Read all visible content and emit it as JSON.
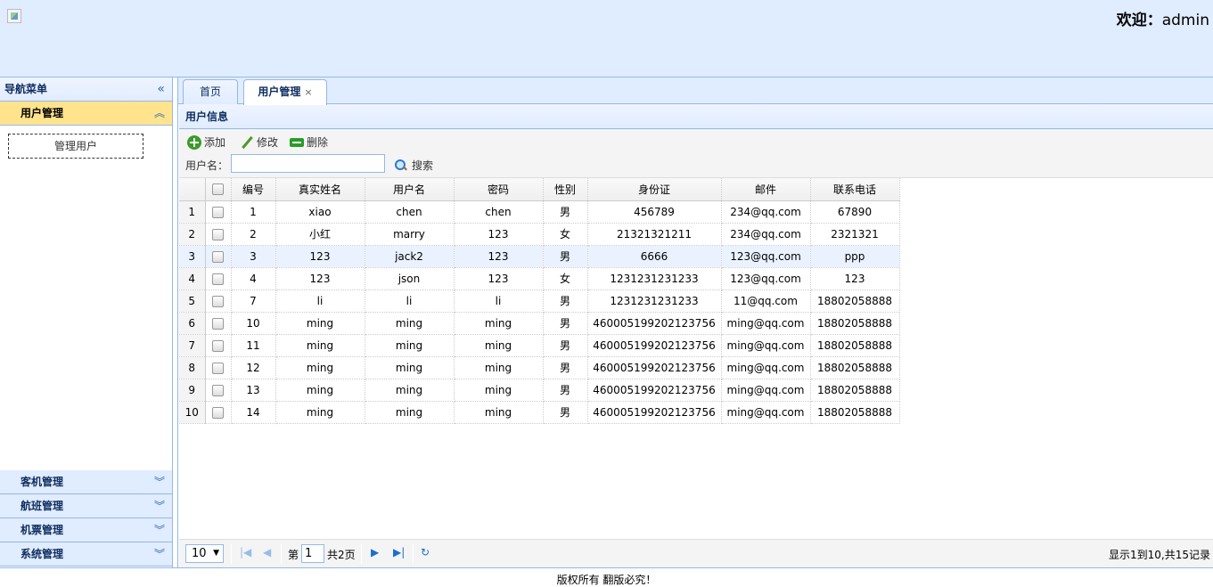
{
  "header": {
    "welcome_label": "欢迎：",
    "username": "admin"
  },
  "west": {
    "title": "导航菜单",
    "accordion": [
      {
        "label": "用户管理"
      },
      {
        "label": "客机管理"
      },
      {
        "label": "航班管理"
      },
      {
        "label": "机票管理"
      },
      {
        "label": "系统管理"
      }
    ],
    "user_mgmt_link": "管理用户"
  },
  "tabs": [
    {
      "label": "首页"
    },
    {
      "label": "用户管理"
    }
  ],
  "grid": {
    "title": "用户信息",
    "toolbar": {
      "add": "添加",
      "edit": "修改",
      "remove": "删除",
      "search_label": "用户名：",
      "search_value": "",
      "search_button": "搜索"
    },
    "columns": [
      "编号",
      "真实姓名",
      "用户名",
      "密码",
      "性别",
      "身份证",
      "邮件",
      "联系电话"
    ],
    "rows": [
      [
        "1",
        "xiao",
        "chen",
        "chen",
        "男",
        "456789",
        "234@qq.com",
        "67890"
      ],
      [
        "2",
        "小红",
        "marry",
        "123",
        "女",
        "21321321211",
        "234@qq.com",
        "2321321"
      ],
      [
        "3",
        "123",
        "jack2",
        "123",
        "男",
        "6666",
        "123@qq.com",
        "ppp"
      ],
      [
        "4",
        "123",
        "json",
        "123",
        "女",
        "1231231231233",
        "123@qq.com",
        "123"
      ],
      [
        "7",
        "li",
        "li",
        "li",
        "男",
        "1231231231233",
        "11@qq.com",
        "18802058888"
      ],
      [
        "10",
        "ming",
        "ming",
        "ming",
        "男",
        "460005199202123756",
        "ming@qq.com",
        "18802058888"
      ],
      [
        "11",
        "ming",
        "ming",
        "ming",
        "男",
        "460005199202123756",
        "ming@qq.com",
        "18802058888"
      ],
      [
        "12",
        "ming",
        "ming",
        "ming",
        "男",
        "460005199202123756",
        "ming@qq.com",
        "18802058888"
      ],
      [
        "13",
        "ming",
        "ming",
        "ming",
        "男",
        "460005199202123756",
        "ming@qq.com",
        "18802058888"
      ],
      [
        "14",
        "ming",
        "ming",
        "ming",
        "男",
        "460005199202123756",
        "ming@qq.com",
        "18802058888"
      ]
    ],
    "highlighted_row": 3
  },
  "pager": {
    "page_size": "10",
    "page_prefix": "第",
    "page_number": "1",
    "page_total": "共2页",
    "info": "显示1到10,共15记录"
  },
  "footer": {
    "text": "版权所有 翻版必究！"
  },
  "icons": {
    "collapse_west": "double-chevron-left-icon",
    "accordion_expanded": "double-chevron-up-icon",
    "accordion_collapsed": "double-chevron-down-icon",
    "tab_close": "close-icon"
  }
}
